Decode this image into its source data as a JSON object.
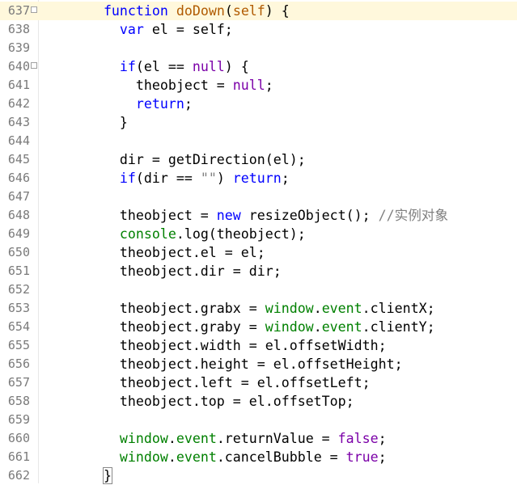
{
  "editor": {
    "lines": [
      {
        "num": "637",
        "fold": "⊟",
        "indent": "        ",
        "segs": [
          {
            "t": "function",
            "c": "kw"
          },
          {
            "t": " ",
            "c": ""
          },
          {
            "t": "doDown",
            "c": "fn"
          },
          {
            "t": "(",
            "c": ""
          },
          {
            "t": "self",
            "c": "fn"
          },
          {
            "t": ") {",
            "c": ""
          }
        ]
      },
      {
        "num": "638",
        "fold": "",
        "indent": "          ",
        "segs": [
          {
            "t": "var",
            "c": "kw"
          },
          {
            "t": " el = self;",
            "c": ""
          }
        ]
      },
      {
        "num": "639",
        "fold": "",
        "indent": "",
        "segs": []
      },
      {
        "num": "640",
        "fold": "⊟",
        "indent": "          ",
        "segs": [
          {
            "t": "if",
            "c": "kw"
          },
          {
            "t": "(el == ",
            "c": ""
          },
          {
            "t": "null",
            "c": "vr"
          },
          {
            "t": ") {",
            "c": ""
          }
        ]
      },
      {
        "num": "641",
        "fold": "",
        "indent": "            ",
        "segs": [
          {
            "t": "theobject = ",
            "c": ""
          },
          {
            "t": "null",
            "c": "vr"
          },
          {
            "t": ";",
            "c": ""
          }
        ]
      },
      {
        "num": "642",
        "fold": "",
        "indent": "            ",
        "segs": [
          {
            "t": "return",
            "c": "kw"
          },
          {
            "t": ";",
            "c": ""
          }
        ]
      },
      {
        "num": "643",
        "fold": "",
        "indent": "          ",
        "segs": [
          {
            "t": "}",
            "c": ""
          }
        ]
      },
      {
        "num": "644",
        "fold": "",
        "indent": "",
        "segs": []
      },
      {
        "num": "645",
        "fold": "",
        "indent": "          ",
        "segs": [
          {
            "t": "dir = getDirection(el);",
            "c": ""
          }
        ]
      },
      {
        "num": "646",
        "fold": "",
        "indent": "          ",
        "segs": [
          {
            "t": "if",
            "c": "kw"
          },
          {
            "t": "(dir == ",
            "c": ""
          },
          {
            "t": "\"\"",
            "c": "cm"
          },
          {
            "t": ") ",
            "c": ""
          },
          {
            "t": "return",
            "c": "kw"
          },
          {
            "t": ";",
            "c": ""
          }
        ]
      },
      {
        "num": "647",
        "fold": "",
        "indent": "",
        "segs": []
      },
      {
        "num": "648",
        "fold": "",
        "indent": "          ",
        "segs": [
          {
            "t": "theobject = ",
            "c": ""
          },
          {
            "t": "new",
            "c": "kw"
          },
          {
            "t": " resizeObject(); ",
            "c": ""
          },
          {
            "t": "//实例对象",
            "c": "cm"
          }
        ]
      },
      {
        "num": "649",
        "fold": "",
        "indent": "          ",
        "segs": [
          {
            "t": "console",
            "c": "gr"
          },
          {
            "t": ".log(theobject);",
            "c": ""
          }
        ]
      },
      {
        "num": "650",
        "fold": "",
        "indent": "          ",
        "segs": [
          {
            "t": "theobject.el = el;",
            "c": ""
          }
        ]
      },
      {
        "num": "651",
        "fold": "",
        "indent": "          ",
        "segs": [
          {
            "t": "theobject.dir = dir;",
            "c": ""
          }
        ]
      },
      {
        "num": "652",
        "fold": "",
        "indent": "",
        "segs": []
      },
      {
        "num": "653",
        "fold": "",
        "indent": "          ",
        "segs": [
          {
            "t": "theobject.grabx = ",
            "c": ""
          },
          {
            "t": "window",
            "c": "gr"
          },
          {
            "t": ".",
            "c": ""
          },
          {
            "t": "event",
            "c": "gr"
          },
          {
            "t": ".clientX;",
            "c": ""
          }
        ]
      },
      {
        "num": "654",
        "fold": "",
        "indent": "          ",
        "segs": [
          {
            "t": "theobject.graby = ",
            "c": ""
          },
          {
            "t": "window",
            "c": "gr"
          },
          {
            "t": ".",
            "c": ""
          },
          {
            "t": "event",
            "c": "gr"
          },
          {
            "t": ".clientY;",
            "c": ""
          }
        ]
      },
      {
        "num": "655",
        "fold": "",
        "indent": "          ",
        "segs": [
          {
            "t": "theobject.width = el.offsetWidth;",
            "c": ""
          }
        ]
      },
      {
        "num": "656",
        "fold": "",
        "indent": "          ",
        "segs": [
          {
            "t": "theobject.height = el.offsetHeight;",
            "c": ""
          }
        ]
      },
      {
        "num": "657",
        "fold": "",
        "indent": "          ",
        "segs": [
          {
            "t": "theobject.left = el.offsetLeft;",
            "c": ""
          }
        ]
      },
      {
        "num": "658",
        "fold": "",
        "indent": "          ",
        "segs": [
          {
            "t": "theobject.top = el.offsetTop;",
            "c": ""
          }
        ]
      },
      {
        "num": "659",
        "fold": "",
        "indent": "",
        "segs": []
      },
      {
        "num": "660",
        "fold": "",
        "indent": "          ",
        "segs": [
          {
            "t": "window",
            "c": "gr"
          },
          {
            "t": ".",
            "c": ""
          },
          {
            "t": "event",
            "c": "gr"
          },
          {
            "t": ".returnValue = ",
            "c": ""
          },
          {
            "t": "false",
            "c": "vr"
          },
          {
            "t": ";",
            "c": ""
          }
        ]
      },
      {
        "num": "661",
        "fold": "",
        "indent": "          ",
        "segs": [
          {
            "t": "window",
            "c": "gr"
          },
          {
            "t": ".",
            "c": ""
          },
          {
            "t": "event",
            "c": "gr"
          },
          {
            "t": ".cancelBubble = ",
            "c": ""
          },
          {
            "t": "true",
            "c": "vr"
          },
          {
            "t": ";",
            "c": ""
          }
        ]
      },
      {
        "num": "662",
        "fold": "",
        "indent": "        ",
        "segs": [
          {
            "t": "}",
            "c": "brace"
          }
        ]
      }
    ]
  }
}
